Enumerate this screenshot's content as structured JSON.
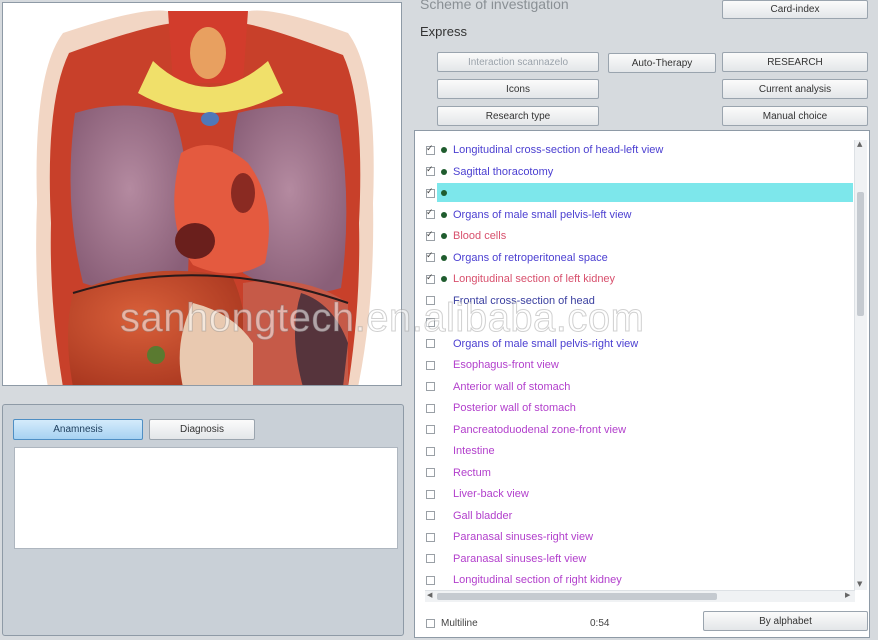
{
  "header": {
    "title": "Scheme of investigation",
    "mode_label": "Express"
  },
  "buttons": {
    "card_index": "Card-index",
    "interaction_scan": "Interaction scannazelo",
    "auto_therapy": "Auto-Therapy",
    "research": "RESEARCH",
    "icons": "Icons",
    "current_analysis": "Current analysis",
    "research_type": "Research type",
    "manual_choice": "Manual choice",
    "anamnesis": "Anamnesis",
    "diagnosis": "Diagnosis",
    "by_alphabet": "By alphabet"
  },
  "list": {
    "items": [
      {
        "label": "Longitudinal cross-section of head-left view",
        "checked": true,
        "dot": true,
        "color": "blue"
      },
      {
        "label": "Sagittal thoracotomy",
        "checked": true,
        "dot": true,
        "color": "blue"
      },
      {
        "label": "",
        "checked": true,
        "dot": true,
        "color": "blue"
      },
      {
        "label": "Organs of male small pelvis-left view",
        "checked": true,
        "dot": true,
        "color": "blue"
      },
      {
        "label": "Blood cells",
        "checked": true,
        "dot": true,
        "color": "rose"
      },
      {
        "label": "Organs of retroperitoneal space",
        "checked": true,
        "dot": true,
        "color": "blue"
      },
      {
        "label": "Longitudinal section of left kidney",
        "checked": true,
        "dot": true,
        "color": "rose"
      },
      {
        "label": "Frontal cross-section of head",
        "checked": false,
        "dot": false,
        "color": "dark"
      },
      {
        "label": "",
        "checked": false,
        "dot": false,
        "color": "dark"
      },
      {
        "label": "Organs of male small pelvis-right view",
        "checked": false,
        "dot": false,
        "color": "blue"
      },
      {
        "label": "Esophagus-front view",
        "checked": false,
        "dot": false,
        "color": "violet"
      },
      {
        "label": "Anterior wall of stomach",
        "checked": false,
        "dot": false,
        "color": "violet"
      },
      {
        "label": "Posterior wall of stomach",
        "checked": false,
        "dot": false,
        "color": "violet"
      },
      {
        "label": "Pancreatoduodenal zone-front view",
        "checked": false,
        "dot": false,
        "color": "violet"
      },
      {
        "label": "Intestine",
        "checked": false,
        "dot": false,
        "color": "violet"
      },
      {
        "label": "Rectum",
        "checked": false,
        "dot": false,
        "color": "violet"
      },
      {
        "label": "Liver-back view",
        "checked": false,
        "dot": false,
        "color": "violet"
      },
      {
        "label": "Gall bladder",
        "checked": false,
        "dot": false,
        "color": "violet"
      },
      {
        "label": "Paranasal sinuses-right view",
        "checked": false,
        "dot": false,
        "color": "violet"
      },
      {
        "label": "Paranasal sinuses-left view",
        "checked": false,
        "dot": false,
        "color": "violet"
      },
      {
        "label": "Longitudinal section of right kidney",
        "checked": false,
        "dot": false,
        "color": "violet"
      }
    ]
  },
  "footer": {
    "multiline_label": "Multiline",
    "time": "0:54"
  },
  "watermark": "sanhongtech.en.alibaba.com",
  "colors": {
    "highlight": "#66e3e8",
    "active_tab": "#a7d2f2",
    "item_blue": "#4b3fd1",
    "item_violet": "#b23fcc",
    "item_rose": "#d8506d"
  }
}
